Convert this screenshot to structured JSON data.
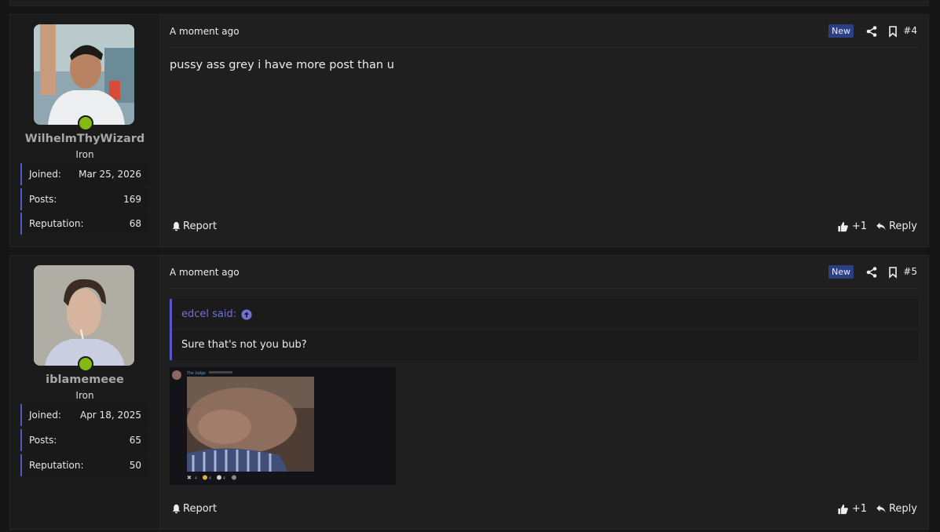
{
  "posts": [
    {
      "user": {
        "name": "WilhelmThyWizard",
        "rank": "Iron",
        "stats": [
          {
            "label": "Joined:",
            "value": "Mar 25, 2026"
          },
          {
            "label": "Posts:",
            "value": "169"
          },
          {
            "label": "Reputation:",
            "value": "68"
          }
        ]
      },
      "time": "A moment ago",
      "badge": "New",
      "number": "#4",
      "text": "pussy ass grey i have more post than u",
      "report": "Report",
      "likes": "+1",
      "reply": "Reply"
    },
    {
      "user": {
        "name": "iblamemeee",
        "rank": "Iron",
        "stats": [
          {
            "label": "Joined:",
            "value": "Apr 18, 2025"
          },
          {
            "label": "Posts:",
            "value": "65"
          },
          {
            "label": "Reputation:",
            "value": "50"
          }
        ]
      },
      "time": "A moment ago",
      "badge": "New",
      "number": "#5",
      "quote": {
        "author": "edcel said:",
        "text": "Sure that's not you bub?"
      },
      "attachment": {
        "poster": "The Judge",
        "reactions": [
          "4",
          "4",
          "4"
        ]
      },
      "report": "Report",
      "likes": "+1",
      "reply": "Reply"
    }
  ],
  "colors": {
    "accent": "#5458c8",
    "online": "#86b813",
    "badge_bg": "#2b3f82",
    "quote_author": "#6f73d6"
  }
}
